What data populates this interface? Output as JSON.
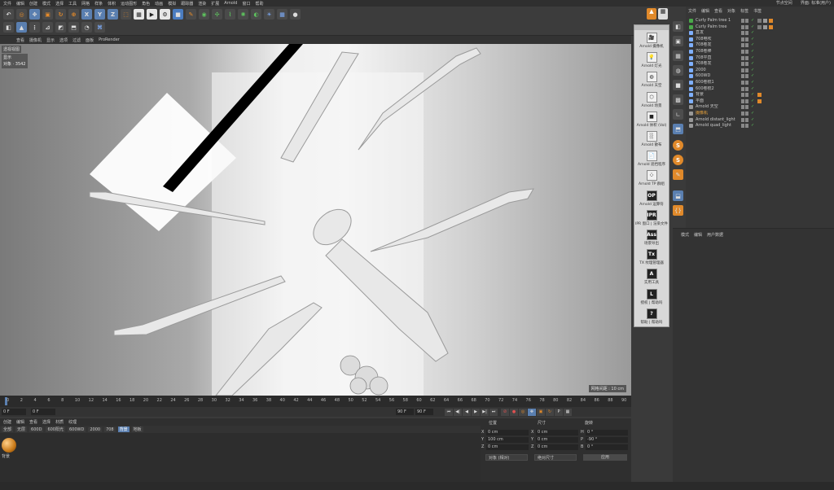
{
  "menubar": {
    "items": [
      "文件",
      "编辑",
      "创建",
      "模式",
      "选择",
      "工具",
      "网格",
      "样条",
      "体积",
      "运动图形",
      "角色",
      "动画",
      "模拟",
      "跟踪器",
      "渲染",
      "扩展",
      "Arnold",
      "窗口",
      "帮助"
    ],
    "right": [
      "节点空间",
      "界面: 标准(用户)"
    ]
  },
  "toolbar": {
    "row1": [
      {
        "icon": "undo-icon",
        "glyph": "↶"
      },
      {
        "icon": "live-select-icon",
        "glyph": "◎",
        "style": "orange"
      },
      {
        "icon": "move-icon",
        "glyph": "✥",
        "style": "hi"
      },
      {
        "icon": "scale-icon",
        "glyph": "▣",
        "style": "orange"
      },
      {
        "icon": "rotate-icon",
        "glyph": "↻",
        "style": "orange"
      },
      {
        "icon": "recent-icon",
        "glyph": "⊕",
        "style": "orange"
      },
      {
        "icon": "axis-x-icon",
        "glyph": "X",
        "style": "hi"
      },
      {
        "icon": "axis-y-icon",
        "glyph": "Y",
        "style": "hi"
      },
      {
        "icon": "axis-z-icon",
        "glyph": "Z",
        "style": "hi"
      },
      {
        "icon": "coord-system-icon",
        "glyph": "⬚",
        "style": "orange"
      },
      {
        "icon": "render-view-icon",
        "glyph": "▦",
        "style": "box"
      },
      {
        "icon": "render-picture-icon",
        "glyph": "▶",
        "style": "box"
      },
      {
        "icon": "render-settings-icon",
        "glyph": "⚙",
        "style": "box"
      },
      {
        "icon": "cube-icon",
        "glyph": "■",
        "style": "cube"
      },
      {
        "icon": "pen-icon",
        "glyph": "✎",
        "style": "orange"
      },
      {
        "icon": "subdivision-icon",
        "glyph": "◉",
        "style": "green"
      },
      {
        "icon": "cloner-icon",
        "glyph": "✣",
        "style": "green"
      },
      {
        "icon": "deformer-icon",
        "glyph": "⌇",
        "style": "green"
      },
      {
        "icon": "environment-icon",
        "glyph": "✺",
        "style": "green"
      },
      {
        "icon": "camera-icon",
        "glyph": "◐",
        "style": "green"
      },
      {
        "icon": "light-icon",
        "glyph": "☀",
        "style": "blue"
      },
      {
        "icon": "grid-icon",
        "glyph": "▦",
        "style": "blue"
      },
      {
        "icon": "bulb-icon",
        "glyph": "●"
      }
    ],
    "row2": [
      {
        "icon": "make-editable-icon",
        "glyph": "◧"
      },
      {
        "icon": "polygon-mode-icon",
        "glyph": "▲",
        "style": "hi"
      },
      {
        "icon": "point-mode-icon",
        "glyph": "⋮"
      },
      {
        "icon": "edge-mode-icon",
        "glyph": "⊿"
      },
      {
        "icon": "texture-mode-icon",
        "glyph": "◩"
      },
      {
        "icon": "workplane-icon",
        "glyph": "⬒"
      },
      {
        "icon": "snap-icon",
        "glyph": "◔"
      },
      {
        "icon": "python-icon",
        "glyph": "⌘",
        "style": "blue"
      }
    ]
  },
  "viewport": {
    "menu": [
      "查看",
      "摄像机",
      "显示",
      "选项",
      "过滤",
      "面板",
      "ProRender"
    ],
    "label": "透视视图",
    "info": [
      "显示",
      "对象 · 3542"
    ],
    "grid_scale": "网格间距 : 10 cm"
  },
  "timeline": {
    "ticks": [
      "0",
      "2",
      "4",
      "6",
      "8",
      "10",
      "12",
      "14",
      "16",
      "18",
      "20",
      "22",
      "24",
      "26",
      "28",
      "30",
      "32",
      "34",
      "36",
      "38",
      "40",
      "42",
      "44",
      "46",
      "48",
      "50",
      "52",
      "54",
      "56",
      "58",
      "60",
      "62",
      "64",
      "66",
      "68",
      "70",
      "72",
      "74",
      "76",
      "78",
      "80",
      "82",
      "84",
      "86",
      "88",
      "90"
    ]
  },
  "transport": {
    "current": "0 F",
    "start": "0 F",
    "end": "90 F",
    "end2": "90 F"
  },
  "bottom": {
    "tabs": [
      "创建",
      "编辑",
      "查看",
      "选择",
      "材质",
      "纹理"
    ],
    "materials": [
      "全部",
      "无层",
      "600D",
      "600阳光",
      "600WD",
      "2000",
      "708",
      "背景",
      "地板"
    ],
    "material_name": "背景"
  },
  "coords": {
    "headers": [
      "位置",
      "尺寸",
      "旋转"
    ],
    "rows": [
      {
        "axis": "X",
        "pos": "0 cm",
        "size": "0 cm",
        "rlabel": "H",
        "rot": "0 °"
      },
      {
        "axis": "Y",
        "pos": "100 cm",
        "size": "0 cm",
        "rlabel": "P",
        "rot": "-90 °"
      },
      {
        "axis": "Z",
        "pos": "0 cm",
        "size": "0 cm",
        "rlabel": "B",
        "rot": "0 °"
      }
    ],
    "mode": "对象 (相对)",
    "size_mode": "绝对尺寸",
    "apply": "应用"
  },
  "arnold": {
    "items": [
      {
        "label": "Arnold 摄像机",
        "glyph": "🎥"
      },
      {
        "label": "Arnold 灯光",
        "glyph": "💡"
      },
      {
        "label": "Arnold 天空",
        "glyph": "◍"
      },
      {
        "label": "Arnold 场景",
        "glyph": "⬡"
      },
      {
        "label": "Arnold 体积 (Vol)",
        "glyph": "■"
      },
      {
        "label": "Arnold 散布",
        "glyph": "░"
      },
      {
        "label": "Arnold 遮挡程序",
        "glyph": "📄"
      },
      {
        "label": "Arnold TP 群组",
        "glyph": "⁘"
      },
      {
        "label": "Arnold 运算符",
        "glyph": "OP"
      },
      {
        "label": "IPR 窗口 | 渲染文件",
        "glyph": "IPR"
      },
      {
        "label": "场景导出",
        "glyph": "Ass"
      },
      {
        "label": "TX 纹理管理器",
        "glyph": "Tx"
      },
      {
        "label": "实用工具",
        "glyph": "A"
      },
      {
        "label": "授权 | 帮助吗",
        "glyph": "L"
      },
      {
        "label": "帮助 | 帮助吗",
        "glyph": "?"
      }
    ]
  },
  "object_manager": {
    "menu": [
      "文件",
      "编辑",
      "查看",
      "对象",
      "标签",
      "书签"
    ],
    "objects": [
      {
        "name": "Curly Palm tree 1",
        "color": "#4aa84a",
        "tags": true
      },
      {
        "name": "Curly Palm tree",
        "color": "#4aa84a",
        "tags": true
      },
      {
        "name": "直发",
        "color": "#7fb0ff"
      },
      {
        "name": "708电吹",
        "color": "#7fb0ff"
      },
      {
        "name": "708卷发",
        "color": "#7fb0ff"
      },
      {
        "name": "708卷棒",
        "color": "#7fb0ff"
      },
      {
        "name": "708平直",
        "color": "#7fb0ff"
      },
      {
        "name": "708卷发",
        "color": "#7fb0ff"
      },
      {
        "name": "2000",
        "color": "#7fb0ff"
      },
      {
        "name": "600WD",
        "color": "#7fb0ff"
      },
      {
        "name": "600卷梳1",
        "color": "#7fb0ff"
      },
      {
        "name": "600卷梳2",
        "color": "#7fb0ff"
      },
      {
        "name": "背景",
        "color": "#7fb0ff",
        "tag": "#e0892a"
      },
      {
        "name": "平面",
        "color": "#7fb0ff",
        "tag": "#e0892a"
      },
      {
        "name": "Arnold 天空",
        "color": "#999"
      },
      {
        "name": "摄像机",
        "color": "#999",
        "hl": true
      },
      {
        "name": "Arnold distant_light",
        "color": "#999"
      },
      {
        "name": "Arnold quad_light",
        "color": "#999"
      }
    ]
  },
  "attribute_manager": {
    "menu": [
      "模式",
      "编辑",
      "用户数据"
    ]
  }
}
